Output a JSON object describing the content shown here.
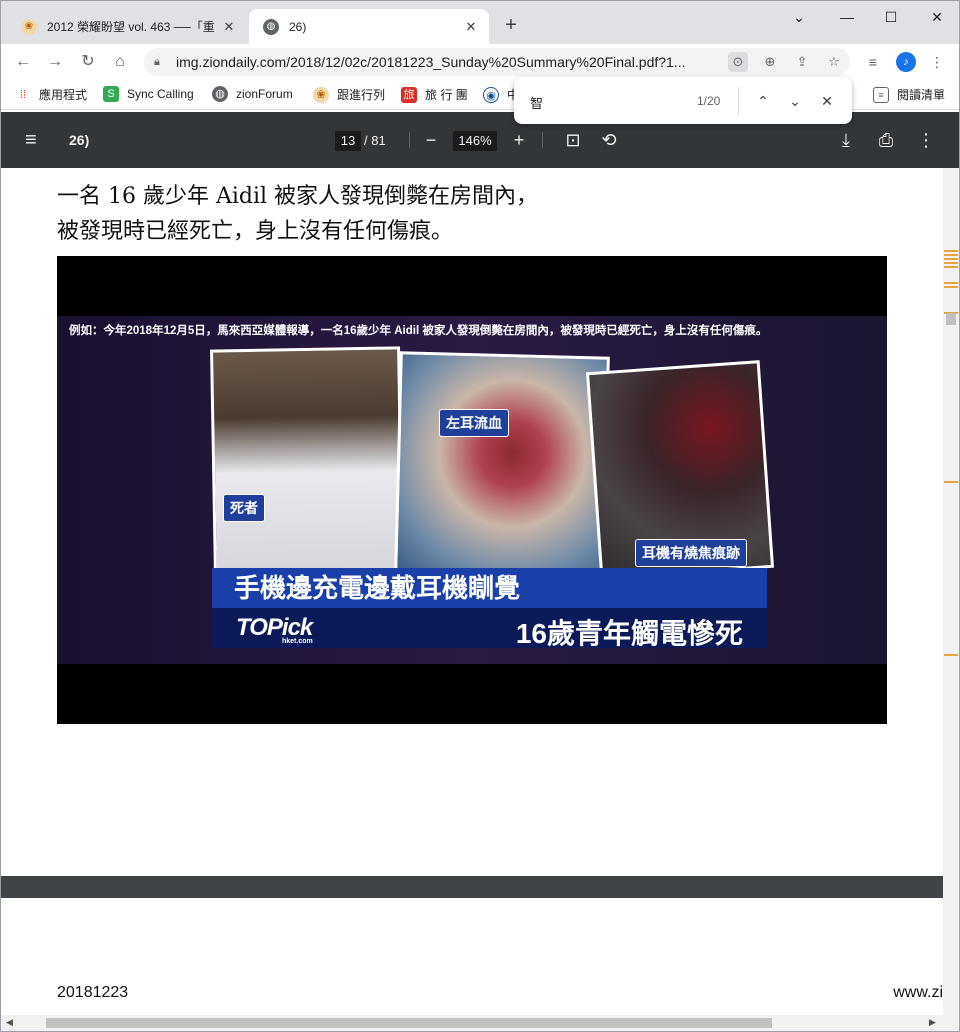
{
  "tabs": [
    {
      "title": "2012 榮耀盼望 vol. 463 ──「重",
      "close": "✕"
    },
    {
      "title": "26)",
      "close": "✕"
    }
  ],
  "new_tab": "+",
  "window_controls": {
    "minimize": "⌄",
    "restore": "—",
    "maximize": "☐",
    "close": "✕"
  },
  "address": {
    "url": "img.ziondaily.com/2018/12/02c/20181223_Sunday%20Summary%20Final.pdf?1..."
  },
  "bookmarks": [
    {
      "label": "應用程式"
    },
    {
      "label": "Sync Calling"
    },
    {
      "label": "zionForum"
    },
    {
      "label": "跟進行列"
    },
    {
      "label": "旅 行 團"
    },
    {
      "label": "中"
    },
    {
      "label": "閱讀清單"
    }
  ],
  "find": {
    "query": "智",
    "count": "1/20"
  },
  "pdf": {
    "title": "26)",
    "page": "13",
    "total": "/ 81",
    "zoom": "146%"
  },
  "content": {
    "line1": "一名 16 歲少年 Aidil 被家人發現倒斃在房間內，",
    "line2": "被發現時已經死亡，身上沒有任何傷痕。",
    "photo": {
      "top_caption": "例如：今年2018年12月5日，馬來西亞媒體報導，一名16歲少年 Aidil 被家人發現倒斃在房間內，被發現時已經死亡，身上沒有任何傷痕。",
      "tag_dead": "死者",
      "tag_ear": "左耳流血",
      "tag_earphone": "耳機有燒焦痕跡",
      "headline": "手機邊充電邊戴耳機瞓覺",
      "subline": "16歲青年觸電慘死",
      "logo": "TOPick",
      "logo_sub": "hket.com"
    },
    "footer_left": "20181223",
    "footer_right": "www.zi"
  }
}
